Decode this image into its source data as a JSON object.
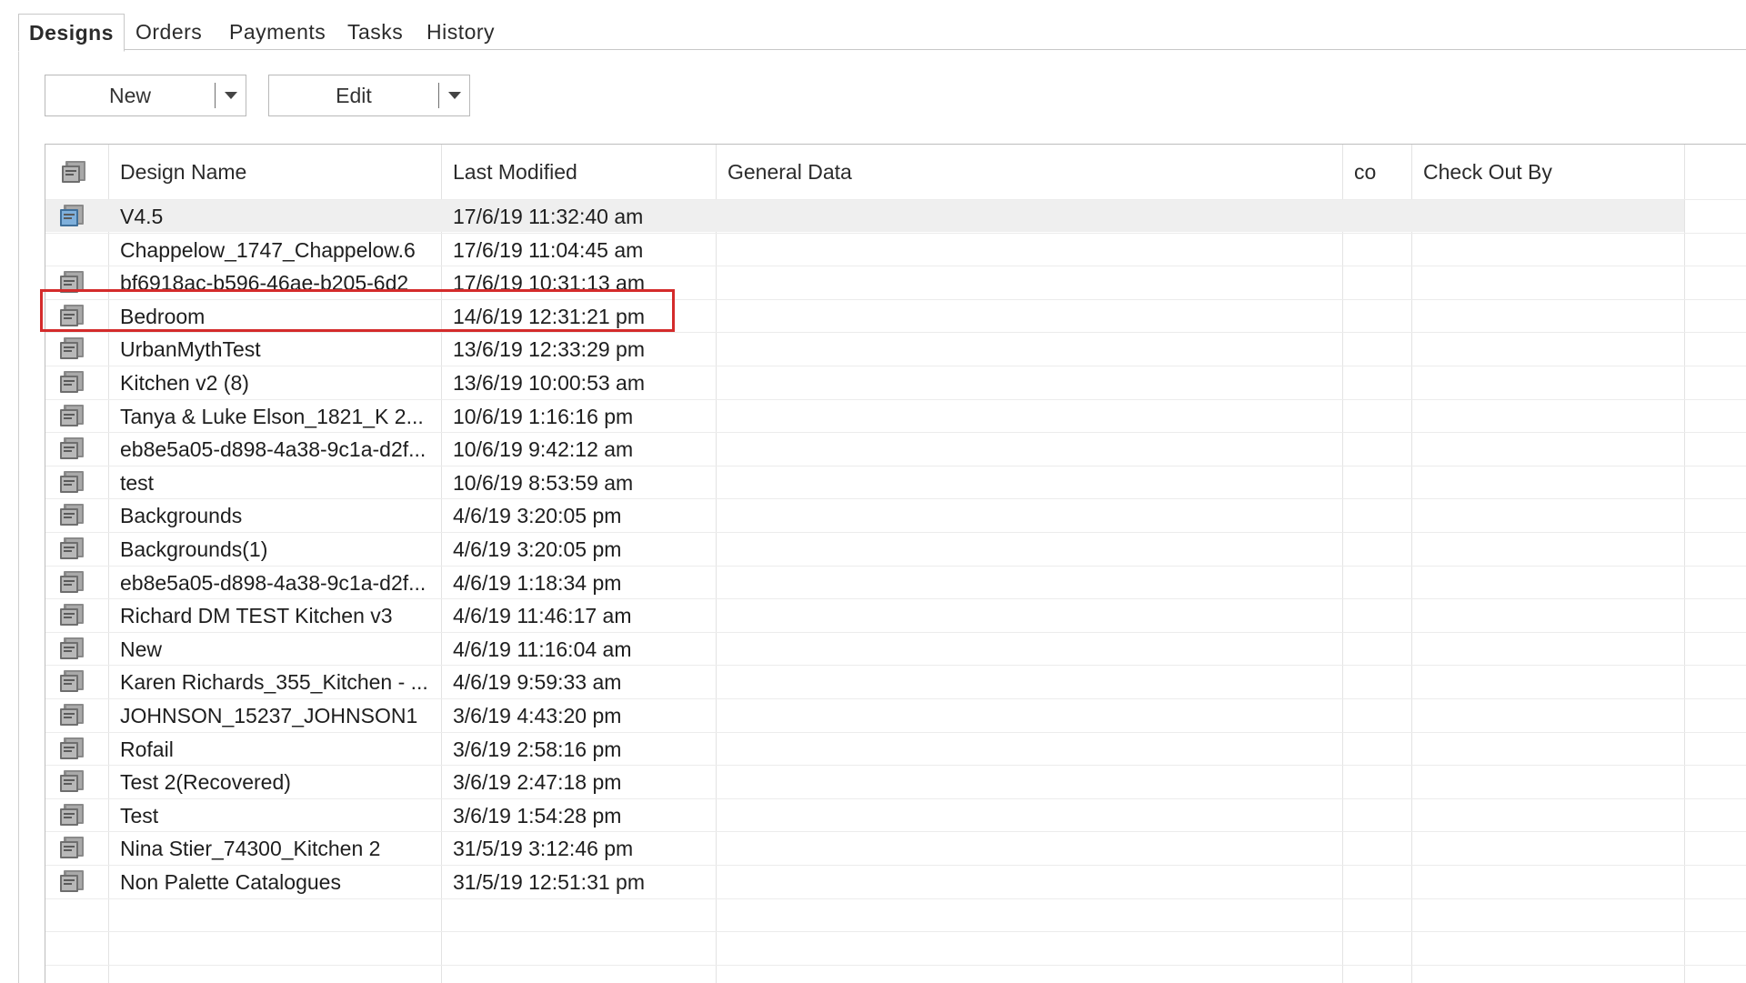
{
  "tabs": [
    {
      "label": "Designs",
      "active": true
    },
    {
      "label": "Orders",
      "active": false
    },
    {
      "label": "Payments",
      "active": false
    },
    {
      "label": "Tasks",
      "active": false
    },
    {
      "label": "History",
      "active": false
    }
  ],
  "toolbar": {
    "new_label": "New",
    "edit_label": "Edit"
  },
  "grid": {
    "columns": [
      "Design Name",
      "Last Modified",
      "General Data",
      "co",
      "Check Out By"
    ],
    "header_icon": "design-file-icon",
    "rows": [
      {
        "name": "V4.5",
        "modified": "17/6/19  11:32:40 am",
        "general": "",
        "co": "",
        "checkout": "",
        "icon": "design-file-icon"
      },
      {
        "name": "Chappelow_1747_Chappelow.6",
        "modified": "17/6/19  11:04:45 am",
        "general": "",
        "co": "",
        "checkout": "",
        "icon": ""
      },
      {
        "name": "bf6918ac-b596-46ae-b205-6d2",
        "modified": "17/6/19  10:31:13 am",
        "general": "",
        "co": "",
        "checkout": "",
        "icon": "design-file-icon"
      },
      {
        "name": "Bedroom",
        "modified": "14/6/19  12:31:21 pm",
        "general": "",
        "co": "",
        "checkout": "",
        "icon": "design-file-icon"
      },
      {
        "name": "UrbanMythTest",
        "modified": "13/6/19  12:33:29 pm",
        "general": "",
        "co": "",
        "checkout": "",
        "icon": "design-file-icon"
      },
      {
        "name": "Kitchen v2 (8)",
        "modified": "13/6/19  10:00:53 am",
        "general": "",
        "co": "",
        "checkout": "",
        "icon": "design-file-icon"
      },
      {
        "name": "Tanya & Luke Elson_1821_K 2...",
        "modified": "10/6/19  1:16:16 pm",
        "general": "",
        "co": "",
        "checkout": "",
        "icon": "design-file-icon"
      },
      {
        "name": "eb8e5a05-d898-4a38-9c1a-d2f...",
        "modified": "10/6/19  9:42:12 am",
        "general": "",
        "co": "",
        "checkout": "",
        "icon": "design-file-icon"
      },
      {
        "name": "test",
        "modified": "10/6/19  8:53:59 am",
        "general": "",
        "co": "",
        "checkout": "",
        "icon": "design-file-icon"
      },
      {
        "name": "Backgrounds",
        "modified": "4/6/19  3:20:05 pm",
        "general": "",
        "co": "",
        "checkout": "",
        "icon": "design-file-icon"
      },
      {
        "name": "Backgrounds(1)",
        "modified": "4/6/19  3:20:05 pm",
        "general": "",
        "co": "",
        "checkout": "",
        "icon": "design-file-icon"
      },
      {
        "name": "eb8e5a05-d898-4a38-9c1a-d2f...",
        "modified": "4/6/19  1:18:34 pm",
        "general": "",
        "co": "",
        "checkout": "",
        "icon": "design-file-icon"
      },
      {
        "name": "Richard DM TEST Kitchen v3",
        "modified": "4/6/19  11:46:17 am",
        "general": "",
        "co": "",
        "checkout": "",
        "icon": "design-file-icon"
      },
      {
        "name": "New",
        "modified": "4/6/19  11:16:04 am",
        "general": "",
        "co": "",
        "checkout": "",
        "icon": "design-file-icon"
      },
      {
        "name": "Karen Richards_355_Kitchen - ...",
        "modified": "4/6/19  9:59:33 am",
        "general": "",
        "co": "",
        "checkout": "",
        "icon": "design-file-icon"
      },
      {
        "name": "JOHNSON_15237_JOHNSON1",
        "modified": "3/6/19  4:43:20 pm",
        "general": "",
        "co": "",
        "checkout": "",
        "icon": "design-file-icon"
      },
      {
        "name": "Rofail",
        "modified": "3/6/19  2:58:16 pm",
        "general": "",
        "co": "",
        "checkout": "",
        "icon": "design-file-icon"
      },
      {
        "name": "Test 2(Recovered)",
        "modified": "3/6/19  2:47:18 pm",
        "general": "",
        "co": "",
        "checkout": "",
        "icon": "design-file-icon"
      },
      {
        "name": "Test",
        "modified": "3/6/19  1:54:28 pm",
        "general": "",
        "co": "",
        "checkout": "",
        "icon": "design-file-icon"
      },
      {
        "name": "Nina Stier_74300_Kitchen 2",
        "modified": "31/5/19  3:12:46 pm",
        "general": "",
        "co": "",
        "checkout": "",
        "icon": "design-file-icon"
      },
      {
        "name": "Non Palette Catalogues",
        "modified": "31/5/19  12:51:31 pm",
        "general": "",
        "co": "",
        "checkout": "",
        "icon": "design-file-icon"
      }
    ],
    "selected_row": 0,
    "highlighted_row": 3
  },
  "colors": {
    "highlight_border": "#d42b2b",
    "selected_row_bg": "#efefef"
  }
}
